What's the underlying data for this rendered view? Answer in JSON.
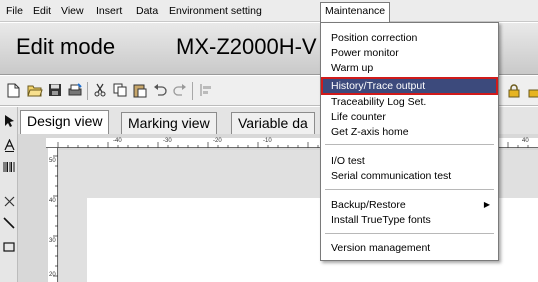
{
  "menubar": {
    "items": [
      {
        "label": "File"
      },
      {
        "label": "Edit"
      },
      {
        "label": "View"
      },
      {
        "label": "Insert"
      },
      {
        "label": "Data"
      },
      {
        "label": "Environment setting"
      },
      {
        "label": "Maintenance"
      }
    ]
  },
  "header": {
    "mode": "Edit mode",
    "model": "MX-Z2000H-V"
  },
  "tabs": [
    {
      "label": "Design view"
    },
    {
      "label": "Marking view"
    },
    {
      "label": "Variable da"
    }
  ],
  "ruler": {
    "h_labels": [
      "-40",
      "-30",
      "-20",
      "-10",
      "40"
    ],
    "v_labels": [
      "50",
      "40",
      "30",
      "20"
    ]
  },
  "maintenance_menu": {
    "items": [
      {
        "label": "Position correction"
      },
      {
        "label": "Power monitor"
      },
      {
        "label": "Warm up"
      },
      {
        "label": "History/Trace output",
        "highlighted": true
      },
      {
        "label": "Traceability Log Set."
      },
      {
        "label": "Life counter"
      },
      {
        "label": "Get Z-axis home"
      },
      {
        "label": "I/O test"
      },
      {
        "label": "Serial communication test"
      },
      {
        "label": "Backup/Restore",
        "submenu": true
      },
      {
        "label": "Install TrueType fonts"
      },
      {
        "label": "Version management"
      }
    ]
  },
  "colors": {
    "highlight_bg": "#3c4a7c",
    "highlight_border": "#d01a1a"
  },
  "icons": {
    "toolbar": [
      "new-document-icon",
      "open-folder-icon",
      "save-icon",
      "print-icon",
      "cut-icon",
      "copy-icon",
      "paste-icon",
      "undo-icon",
      "redo-icon",
      "align-icon",
      "lock-icon"
    ],
    "left_tools": [
      "select-arrow-icon",
      "text-icon",
      "barcode-icon",
      "cross-icon",
      "line-icon",
      "rectangle-icon"
    ]
  }
}
